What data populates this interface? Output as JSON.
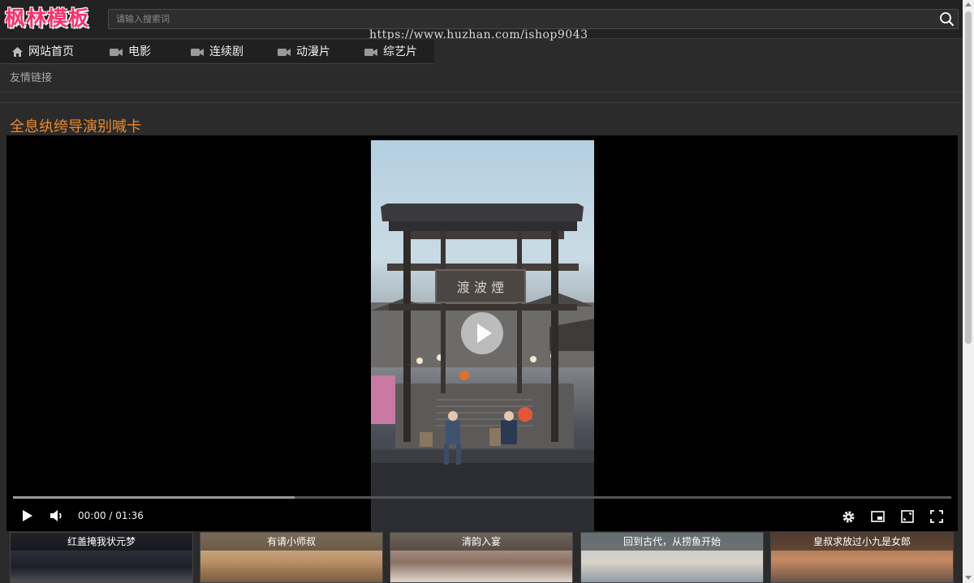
{
  "header": {
    "logo": "枫林模板",
    "search_placeholder": "请输入搜索词",
    "watermark": "https://www.huzhan.com/ishop9043"
  },
  "nav": {
    "items": [
      {
        "label": "网站首页",
        "icon": "home-icon"
      },
      {
        "label": "电影",
        "icon": "video-camera-icon"
      },
      {
        "label": "连续剧",
        "icon": "video-camera-icon"
      },
      {
        "label": "动漫片",
        "icon": "video-camera-icon"
      },
      {
        "label": "综艺片",
        "icon": "video-camera-icon"
      }
    ]
  },
  "friend_links": "友情链接",
  "video": {
    "title": "全息纨绔导演别喊卡",
    "time": "00:00 / 01:36",
    "progress_buffered": 0.3,
    "sign_text": "渡 波 煙"
  },
  "thumbnails": [
    {
      "title": "红盖掩我状元梦"
    },
    {
      "title": "有请小师叔"
    },
    {
      "title": "清韵入宴"
    },
    {
      "title": "回到古代，从捞鱼开始"
    },
    {
      "title": "皇叔求放过小九是女郎"
    }
  ],
  "colors": {
    "logo": "#ff2f6d",
    "title_accent": "#ee8a2a",
    "background": "#2b2b2b"
  }
}
